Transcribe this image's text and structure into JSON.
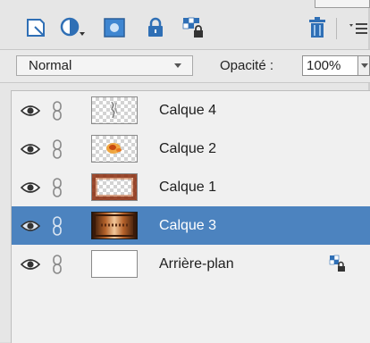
{
  "toolbar": {
    "buttons": [
      {
        "id": "new-layer",
        "icon": "new-layer-icon"
      },
      {
        "id": "adjustment-layer",
        "icon": "adjustment-layer-icon"
      },
      {
        "id": "layer-mask",
        "icon": "layer-mask-icon"
      },
      {
        "id": "lock-all",
        "icon": "lock-icon"
      },
      {
        "id": "lock-transparent",
        "icon": "lock-transparent-pixels-icon"
      },
      {
        "id": "delete-layer",
        "icon": "trash-icon"
      },
      {
        "id": "panel-menu",
        "icon": "panel-menu-icon"
      }
    ]
  },
  "blend": {
    "mode": "Normal",
    "opacity_label": "Opacité :",
    "opacity_value": "100%"
  },
  "layers": [
    {
      "name": "Calque 4",
      "visible": true,
      "selected": false,
      "thumb": "transparent-sketch"
    },
    {
      "name": "Calque 2",
      "visible": true,
      "selected": false,
      "thumb": "transparent-orange-blob"
    },
    {
      "name": "Calque 1",
      "visible": true,
      "selected": false,
      "thumb": "transparent-frame"
    },
    {
      "name": "Calque 3",
      "visible": true,
      "selected": true,
      "thumb": "photo-texture"
    },
    {
      "name": "Arrière-plan",
      "visible": true,
      "selected": false,
      "thumb": "white",
      "locked": true
    }
  ],
  "colors": {
    "selection": "#4c83bf",
    "icon_blue": "#2f6fb5",
    "panel_bg": "#e6e6e6"
  }
}
